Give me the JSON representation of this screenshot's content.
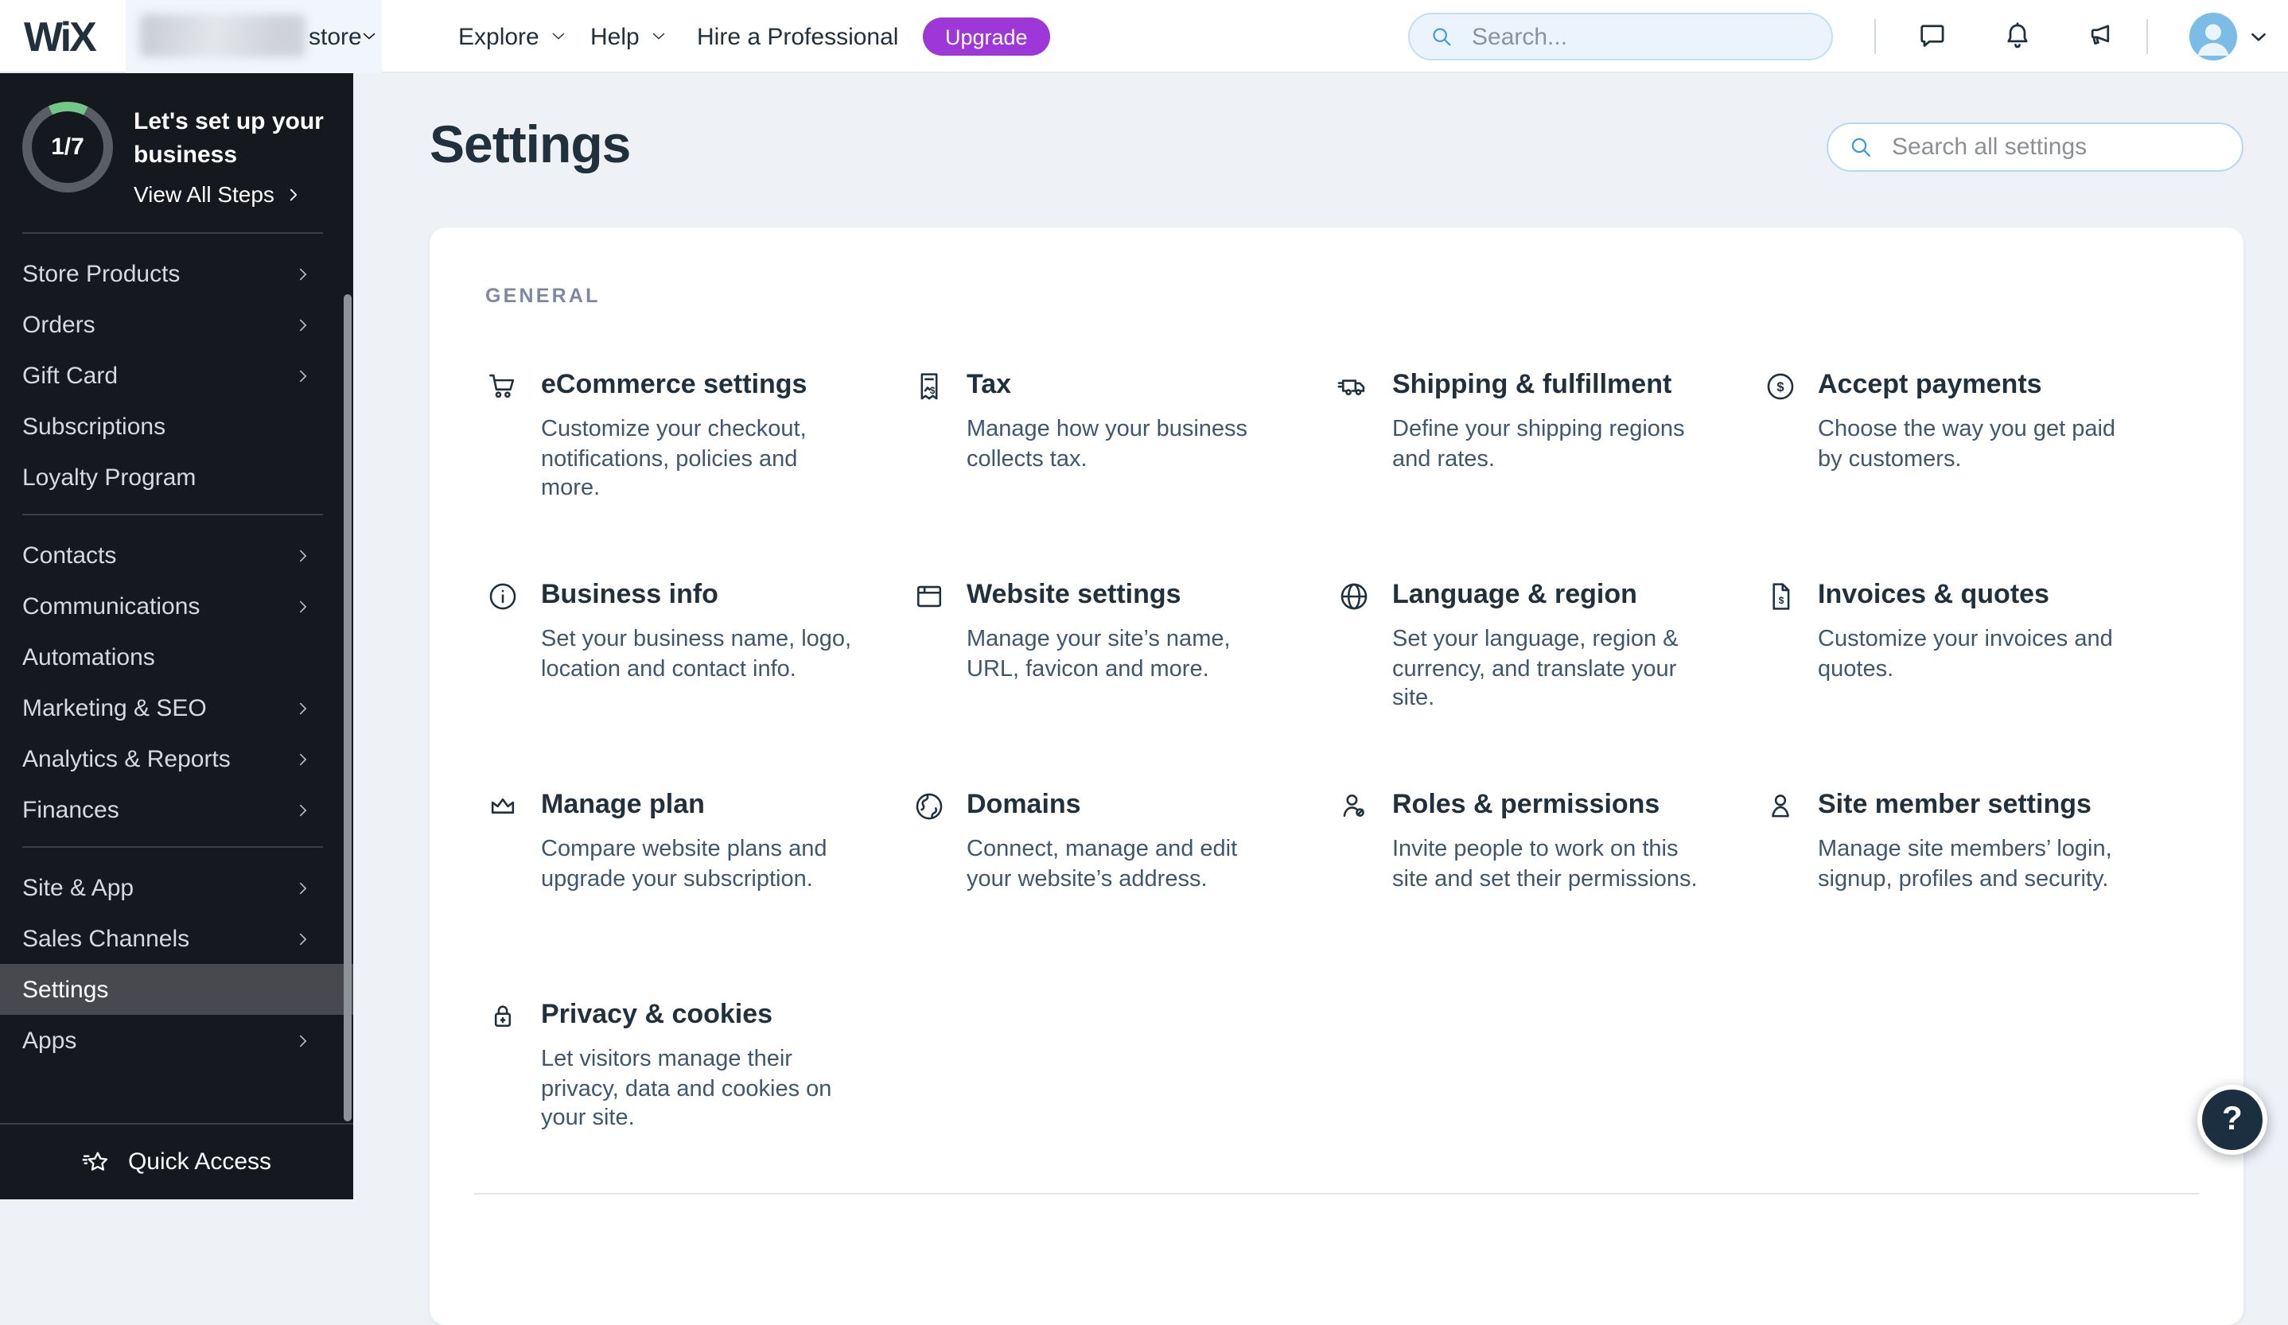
{
  "topbar": {
    "logo": "WiX",
    "site_switcher": {
      "label": "store",
      "chevron_icon": "chevron-down-icon"
    },
    "explore_label": "Explore",
    "help_label": "Help",
    "hire_link": "Hire a Professional",
    "upgrade_button": "Upgrade",
    "search": {
      "placeholder": "Search...",
      "icon": "search-icon"
    },
    "action_icons": [
      "chat-bubble-icon",
      "bell-icon",
      "megaphone-icon"
    ],
    "avatar": {
      "icon": "user-avatar",
      "chevron_icon": "chevron-down-icon"
    }
  },
  "sidebar": {
    "setup": {
      "progress_label": "1/7",
      "progress_fraction": 0.143,
      "title": "Let's set up your business",
      "link_label": "View All Steps"
    },
    "groups": [
      [
        {
          "label": "Store Products",
          "chevron": true
        },
        {
          "label": "Orders",
          "chevron": true
        },
        {
          "label": "Gift Card",
          "chevron": true
        },
        {
          "label": "Subscriptions",
          "chevron": false
        },
        {
          "label": "Loyalty Program",
          "chevron": false
        }
      ],
      [
        {
          "label": "Contacts",
          "chevron": true
        },
        {
          "label": "Communications",
          "chevron": true
        },
        {
          "label": "Automations",
          "chevron": false
        },
        {
          "label": "Marketing & SEO",
          "chevron": true
        },
        {
          "label": "Analytics & Reports",
          "chevron": true
        },
        {
          "label": "Finances",
          "chevron": true
        }
      ],
      [
        {
          "label": "Site & App",
          "chevron": true
        },
        {
          "label": "Sales Channels",
          "chevron": true
        },
        {
          "label": "Settings",
          "chevron": false,
          "selected": true
        },
        {
          "label": "Apps",
          "chevron": true
        }
      ]
    ],
    "quick_access": {
      "label": "Quick Access",
      "icon": "quick-access-star-icon"
    }
  },
  "main": {
    "title": "Settings",
    "search": {
      "placeholder": "Search all settings",
      "icon": "search-icon"
    },
    "section_label": "GENERAL",
    "tiles": [
      {
        "icon": "cart-icon",
        "title": "eCommerce settings",
        "description": "Customize your checkout, notifications, policies and more."
      },
      {
        "icon": "tax-receipt-icon",
        "title": "Tax",
        "description": "Manage how your business collects tax."
      },
      {
        "icon": "truck-icon",
        "title": "Shipping & fulfillment",
        "description": "Define your shipping regions and rates."
      },
      {
        "icon": "dollar-circle-icon",
        "title": "Accept payments",
        "description": "Choose the way you get paid by customers."
      },
      {
        "icon": "info-circle-icon",
        "title": "Business info",
        "description": "Set your business name, logo, location and contact info."
      },
      {
        "icon": "browser-window-icon",
        "title": "Website settings",
        "description": "Manage your site’s name, URL, favicon and more."
      },
      {
        "icon": "globe-icon",
        "title": "Language & region",
        "description": "Set your language, region & currency, and translate your site."
      },
      {
        "icon": "invoice-icon",
        "title": "Invoices & quotes",
        "description": "Customize your invoices and quotes."
      },
      {
        "icon": "crown-icon",
        "title": "Manage plan",
        "description": "Compare website plans and upgrade your subscription."
      },
      {
        "icon": "earth-icon",
        "title": "Domains",
        "description": "Connect, manage and edit your website’s address."
      },
      {
        "icon": "person-key-icon",
        "title": "Roles & permissions",
        "description": "Invite people to work on this site and set their permissions."
      },
      {
        "icon": "person-icon",
        "title": "Site member settings",
        "description": "Manage site members’ login, signup, profiles and security."
      },
      {
        "icon": "lock-icon",
        "title": "Privacy & cookies",
        "description": "Let visitors manage their privacy, data and cookies on your site."
      }
    ]
  },
  "floating_help": {
    "label": "?",
    "icon": "help-question-icon"
  },
  "colors": {
    "accent_blue": "#3899ec",
    "upgrade_purple": "#9e37d8",
    "sidebar_bg": "#15181e",
    "navy": "#20303c",
    "page_bg": "#eef1f6",
    "progress_green": "#72c788",
    "selected_row": "#47494f"
  }
}
